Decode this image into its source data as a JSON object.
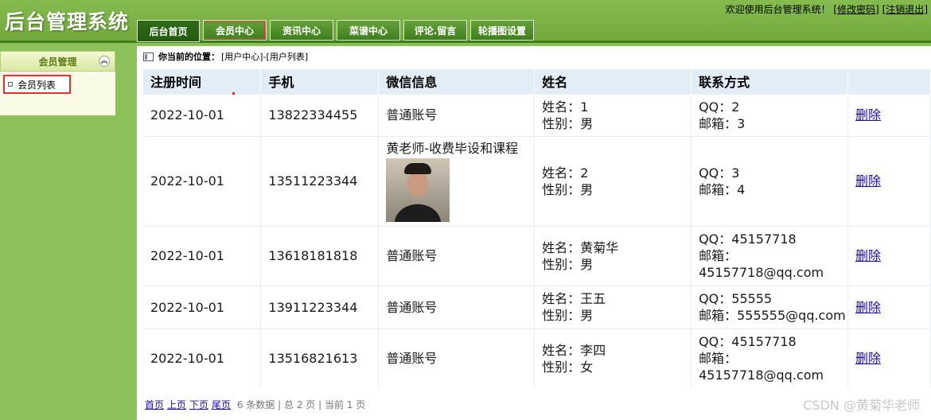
{
  "header": {
    "site_title": "后台管理系统",
    "welcome_text": "欢迎使用后台管理系统！",
    "change_password": "修改密码",
    "logout": "注销退出"
  },
  "nav": {
    "items": [
      "后台首页",
      "会员中心",
      "资讯中心",
      "菜谱中心",
      "评论.留言",
      "轮播图设置"
    ],
    "active": "会员中心"
  },
  "sidebar": {
    "section_title": "会员管理",
    "items": [
      "会员列表"
    ]
  },
  "breadcrumb": {
    "label": "你当前的位置：",
    "path": "[用户中心]-[用户列表]"
  },
  "table": {
    "headers": [
      "注册时间",
      "手机",
      "微信信息",
      "姓名",
      "联系方式",
      ""
    ],
    "rows": [
      {
        "date": "2022-10-01",
        "phone": "13822334455",
        "wechat": "普通账号",
        "name_line": "姓名：1",
        "gender_line": "性别：男",
        "qq_line": "QQ：2",
        "email_line": "邮箱：3",
        "action": "删除"
      },
      {
        "date": "2022-10-01",
        "phone": "13511223344",
        "wechat": "黄老师-收费毕设和课程",
        "name_line": "姓名：2",
        "gender_line": "性别：男",
        "qq_line": "QQ：3",
        "email_line": "邮箱：4",
        "action": "删除"
      },
      {
        "date": "2022-10-01",
        "phone": "13618181818",
        "wechat": "普通账号",
        "name_line": "姓名：黄菊华",
        "gender_line": "性别：男",
        "qq_line": "QQ：45157718",
        "email_line": "邮箱：",
        "email_line2": "45157718@qq.com",
        "action": "删除"
      },
      {
        "date": "2022-10-01",
        "phone": "13911223344",
        "wechat": "普通账号",
        "name_line": "姓名：王五",
        "gender_line": "性别：男",
        "qq_line": "QQ：55555",
        "email_line": "邮箱：555555@qq.com",
        "action": "删除"
      },
      {
        "date": "2022-10-01",
        "phone": "13516821613",
        "wechat": "普通账号",
        "name_line": "姓名：李四",
        "gender_line": "性别：女",
        "qq_line": "QQ：45157718",
        "email_line": "邮箱：",
        "email_line2": "45157718@qq.com",
        "action": "删除"
      }
    ]
  },
  "pager": {
    "first": "首页",
    "prev": "上页",
    "next": "下页",
    "last": "尾页",
    "summary": "6 条数据 | 总 2 页 | 当前 1 页"
  },
  "watermark": "CSDN @黄菊华老师"
}
